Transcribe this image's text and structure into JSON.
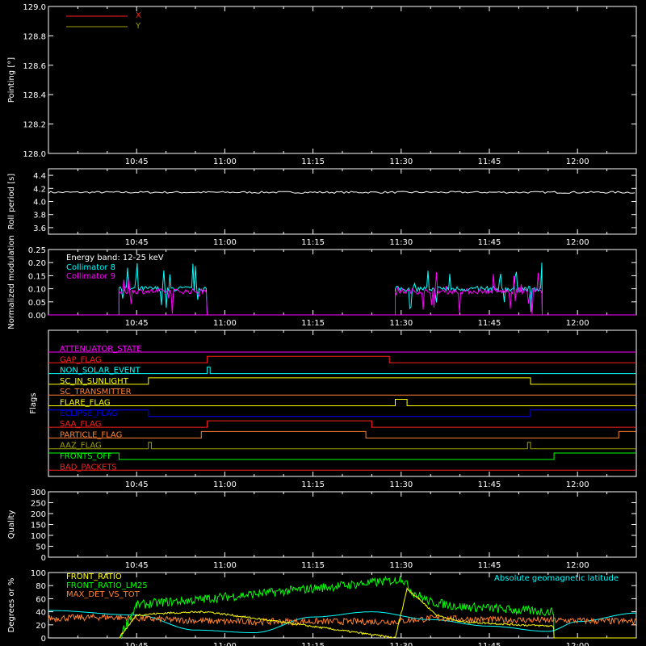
{
  "x_time_ticks": [
    "10:45",
    "11:00",
    "11:15",
    "11:30",
    "11:45",
    "12:00"
  ],
  "x_time_range": [
    "10:30",
    "12:10"
  ],
  "colors": {
    "background": "#000000",
    "axes": "#ffffff",
    "red": "#ff2020",
    "yellow": "#ffff00",
    "cyan": "#00ffff",
    "magenta": "#ff00ff",
    "orange": "#ff8030",
    "green": "#00ff00",
    "blue": "#0000ff",
    "olive": "#a0a000"
  },
  "chart_data": [
    {
      "type": "line",
      "ylabel": "Pointing [°]",
      "ylim": [
        128.0,
        129.0
      ],
      "yticks": [
        "128.0",
        "128.2",
        "128.4",
        "128.6",
        "128.8",
        "129.0"
      ],
      "grid": false,
      "legend_placement": "top-left",
      "series": [
        {
          "name": "X",
          "color": "#ff2020",
          "x": [],
          "values": []
        },
        {
          "name": "Y",
          "color": "#a0a000",
          "x": [],
          "values": []
        }
      ]
    },
    {
      "type": "line",
      "ylabel": "Roll period [s]",
      "ylim": [
        3.5,
        4.5
      ],
      "yticks": [
        "3.6",
        "3.8",
        "4.0",
        "4.2",
        "4.4"
      ],
      "series": [
        {
          "color": "#ffffff",
          "x": [
            "10:30",
            "12:10"
          ],
          "values": [
            4.14,
            4.14
          ]
        }
      ]
    },
    {
      "type": "line",
      "ylabel": "Normalized modulation",
      "ylim": [
        0.0,
        0.25
      ],
      "yticks": [
        "0.00",
        "0.05",
        "0.10",
        "0.15",
        "0.20",
        "0.25"
      ],
      "annotations": [
        "Energy band: 12-25 keV"
      ],
      "legend_placement": "top-left",
      "series": [
        {
          "name": "Collimator 8",
          "color": "#00ffff",
          "intervals": [
            [
              "10:42",
              "10:57"
            ],
            [
              "11:29",
              "11:54"
            ]
          ],
          "typical": 0.1
        },
        {
          "name": "Collimator 9",
          "color": "#ff00ff",
          "intervals": [
            [
              "10:42",
              "10:57"
            ],
            [
              "11:29",
              "11:54"
            ]
          ],
          "typical": 0.09
        }
      ]
    },
    {
      "type": "line",
      "ylabel": "Flags",
      "flags": [
        {
          "name": "ATTENUATOR_STATE",
          "color": "#ff00ff",
          "steps": [
            [
              "10:30",
              0
            ]
          ]
        },
        {
          "name": "GAP_FLAG",
          "color": "#ff2020",
          "steps": [
            [
              "10:30",
              0
            ],
            [
              "10:57",
              1
            ],
            [
              "11:28",
              0
            ]
          ]
        },
        {
          "name": "NON_SOLAR_EVENT",
          "color": "#00ffff",
          "steps": [
            [
              "10:30",
              0
            ],
            [
              "10:57",
              1
            ],
            [
              "10:57.5",
              0
            ]
          ]
        },
        {
          "name": "SC_IN_SUNLIGHT",
          "color": "#ffff00",
          "steps": [
            [
              "10:30",
              0
            ],
            [
              "10:47",
              1
            ],
            [
              "11:52",
              0
            ]
          ]
        },
        {
          "name": "SC_TRANSMITTER",
          "color": "#ff8030",
          "steps": [
            [
              "10:30",
              0
            ]
          ]
        },
        {
          "name": "FLARE_FLAG",
          "color": "#ffff00",
          "steps": [
            [
              "10:30",
              0
            ],
            [
              "11:29",
              1
            ],
            [
              "11:31",
              0
            ]
          ]
        },
        {
          "name": "ECLIPSE_FLAG",
          "color": "#0000ff",
          "steps": [
            [
              "10:30",
              1
            ],
            [
              "10:47",
              0
            ],
            [
              "11:52",
              1
            ]
          ]
        },
        {
          "name": "SAA_FLAG",
          "color": "#ff2020",
          "steps": [
            [
              "10:30",
              0
            ],
            [
              "10:57",
              1
            ],
            [
              "11:25",
              0
            ]
          ]
        },
        {
          "name": "PARTICLE_FLAG",
          "color": "#ff8030",
          "steps": [
            [
              "10:30",
              0
            ],
            [
              "10:56",
              1
            ],
            [
              "11:24",
              0
            ],
            [
              "12:07",
              1
            ]
          ]
        },
        {
          "name": "AAZ_FLAG",
          "color": "#a0a000",
          "steps": [
            [
              "10:30",
              0
            ],
            [
              "10:47",
              1
            ],
            [
              "10:47.5",
              0
            ],
            [
              "11:51.5",
              1
            ],
            [
              "11:52",
              0
            ]
          ]
        },
        {
          "name": "FRONTS_OFF",
          "color": "#00ff00",
          "steps": [
            [
              "10:30",
              1
            ],
            [
              "10:42",
              0
            ],
            [
              "11:56",
              1
            ]
          ]
        },
        {
          "name": "BAD_PACKETS",
          "color": "#ff2020",
          "steps": [
            [
              "10:30",
              0
            ]
          ]
        }
      ]
    },
    {
      "type": "line",
      "ylabel": "Quality",
      "ylim": [
        0,
        300
      ],
      "yticks": [
        "0",
        "50",
        "100",
        "150",
        "200",
        "250",
        "300"
      ],
      "series": []
    },
    {
      "type": "line",
      "ylabel": "Degrees or %",
      "ylim": [
        0,
        100
      ],
      "yticks": [
        "0",
        "20",
        "40",
        "60",
        "80",
        "100"
      ],
      "legend_placement": "top-left",
      "annotations": [
        "Absolute geomagnetic latitude"
      ],
      "series": [
        {
          "name": "FRONT_RATIO",
          "color": "#ffff00",
          "x": [
            "10:42",
            "10:45",
            "10:50",
            "10:57",
            "11:29",
            "11:31",
            "11:33",
            "11:36",
            "11:40",
            "11:46",
            "11:50",
            "11:56"
          ],
          "values": [
            0,
            35,
            38,
            40,
            0,
            75,
            60,
            35,
            25,
            22,
            20,
            18
          ]
        },
        {
          "name": "FRONT_RATIO_LM25",
          "color": "#00ff00",
          "x": [
            "10:42",
            "10:45",
            "10:50",
            "10:55",
            "10:57",
            "11:29",
            "11:30",
            "11:32",
            "11:35",
            "11:40",
            "11:46",
            "11:50",
            "11:56"
          ],
          "values": [
            0,
            50,
            55,
            58,
            60,
            88,
            92,
            70,
            55,
            48,
            45,
            42,
            40
          ]
        },
        {
          "name": "MAX_DET_VS_TOT",
          "color": "#ff8030",
          "x": [
            "10:30",
            "10:40",
            "10:50",
            "11:00",
            "11:29",
            "11:35",
            "11:45",
            "11:55",
            "12:10"
          ],
          "values": [
            30,
            32,
            28,
            25,
            25,
            30,
            28,
            27,
            25
          ]
        },
        {
          "name": "Absolute geomagnetic latitude",
          "color": "#00ffff",
          "x": [
            "10:30",
            "10:45",
            "10:55",
            "11:05",
            "11:15",
            "11:25",
            "11:35",
            "11:45",
            "11:55",
            "12:00",
            "12:10"
          ],
          "values": [
            42,
            35,
            12,
            8,
            32,
            40,
            28,
            18,
            10,
            25,
            38
          ]
        }
      ]
    }
  ]
}
